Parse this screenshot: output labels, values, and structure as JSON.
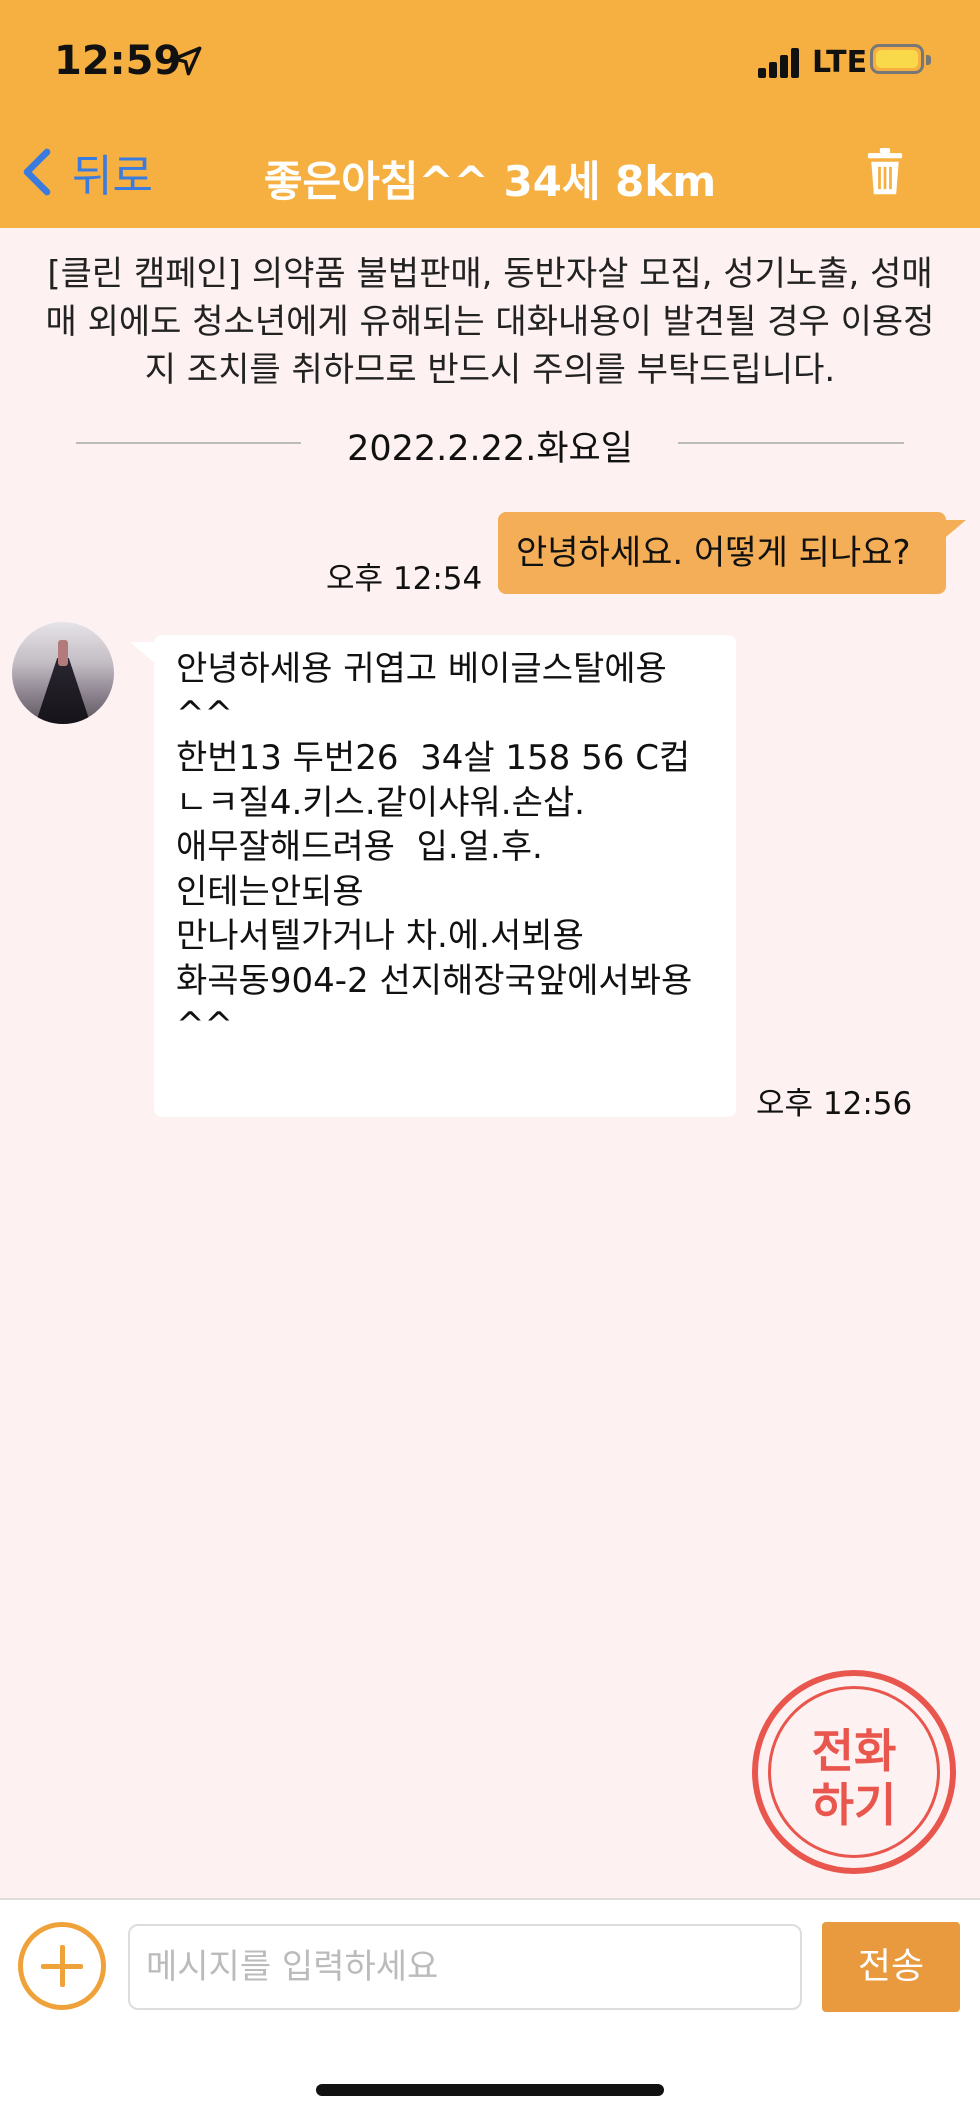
{
  "status_bar": {
    "time": "12:59",
    "network": "LTE"
  },
  "header": {
    "back_label": "뒤로",
    "title": "좋은아침^^ 34세 8km",
    "accent": "#f5b041"
  },
  "notice": "[클린 캠페인] 의약품 불법판매, 동반자살 모집, 성기노출, 성매매 외에도 청소년에게 유해되는 대화내용이 발견될 경우 이용정지 조치를 취하므로 반드시 주의를 부탁드립니다.",
  "date_divider": "2022.2.22.화요일",
  "messages": [
    {
      "direction": "sent",
      "text": "안녕하세요. 어떻게 되나요?",
      "time": "오후 12:54"
    },
    {
      "direction": "received",
      "text": "안녕하세용 귀엽고 베이글스탈에용\n^^\n한번13 두번26  34살 158 56 C컵\nㄴㅋ질4.키스.같이샤워.손삽.\n애무잘해드려용  입.얼.후.\n인테는안되용\n만나서텔가거나 차.에.서뵈용\n화곡동904-2 선지해장국앞에서봐용\n^^",
      "time": "오후 12:56"
    }
  ],
  "call_button": {
    "label": "전화\n하기"
  },
  "composer": {
    "placeholder": "메시지를 입력하세요",
    "send_label": "전송"
  }
}
